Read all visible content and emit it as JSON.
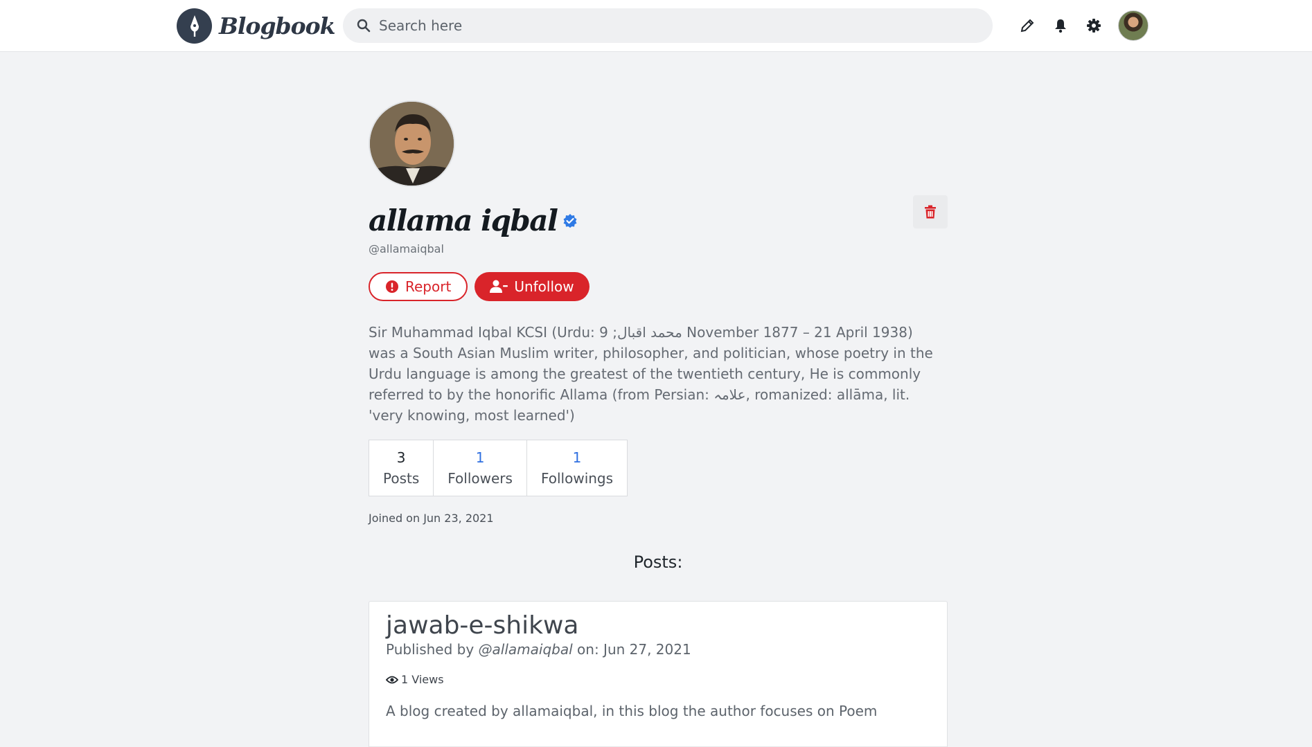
{
  "header": {
    "brand": "Blogbook",
    "search_placeholder": "Search here",
    "icons": [
      "pencil-icon",
      "bell-icon",
      "gear-icon",
      "user-avatar"
    ]
  },
  "profile": {
    "name": "allama iqbal",
    "handle": "@allamaiqbal",
    "verified": true,
    "report_label": "Report",
    "unfollow_label": "Unfollow",
    "bio": "Sir Muhammad Iqbal KCSI (Urdu: محمد اقبال; 9 November 1877 – 21 April 1938) was a South Asian Muslim writer, philosopher, and politician, whose poetry in the Urdu language is among the greatest of the twentieth century, He is commonly referred to by the honorific Allama (from Persian: علامہ, romanized: allāma, lit. 'very knowing, most learned')",
    "stats": [
      {
        "value": "3",
        "label": "Posts"
      },
      {
        "value": "1",
        "label": "Followers"
      },
      {
        "value": "1",
        "label": "Followings"
      }
    ],
    "joined": "Joined on Jun 23, 2021"
  },
  "posts_heading": "Posts:",
  "posts": [
    {
      "title": "jawab-e-shikwa",
      "published_prefix": "Published by",
      "author": "@allamaiqbal",
      "date_text": "on: Jun 27, 2021",
      "views": "1 Views",
      "description": "A blog created by allamaiqbal, in this blog the author focuses on Poem"
    }
  ],
  "colors": {
    "accent_red": "#d9242a",
    "link_blue": "#2f6fe0",
    "verified_blue": "#2f7ae5",
    "page_bg": "#f2f3f5"
  }
}
